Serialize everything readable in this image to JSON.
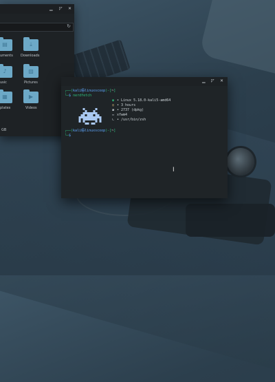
{
  "colors": {
    "prompt_green": "#2ec27e",
    "prompt_blue": "#5fa8ff",
    "folder": "#6da9c7",
    "window_bg": "#1f2427"
  },
  "file_manager": {
    "controls": [
      "minimize-icon",
      "maximize-icon",
      "close-icon"
    ],
    "refresh_icon": "refresh-icon",
    "folders": [
      {
        "label": "uments",
        "icon": "document-folder-icon"
      },
      {
        "label": "Downloads",
        "icon": "download-folder-icon"
      },
      {
        "label": "usic",
        "icon": "music-folder-icon"
      },
      {
        "label": "Pictures",
        "icon": "pictures-folder-icon"
      },
      {
        "label": "plates",
        "icon": "templates-folder-icon"
      },
      {
        "label": "Videos",
        "icon": "videos-folder-icon"
      }
    ],
    "status": "GB"
  },
  "terminal": {
    "controls": [
      "minimize-icon",
      "maximize-icon",
      "close-icon"
    ],
    "prompt": {
      "top_open": "┌──(",
      "user_host": "kali㉿linuxscoop",
      "top_close": ")-[",
      "dir": "~",
      "dir_close": "]",
      "bottom": "└─",
      "dollar": "$ "
    },
    "command": "nerdfetch",
    "info": [
      {
        "icon": "linux-icon",
        "glyph": "◉",
        "text": "• Linux 5.18.0-kali5-amd64"
      },
      {
        "icon": "uptime-icon",
        "glyph": "◎",
        "text": "• 3 hours"
      },
      {
        "icon": "packages-icon",
        "glyph": "◕",
        "text": "• 2737 (dpkg)"
      },
      {
        "icon": "wm-icon",
        "glyph": "▭",
        "text": "xfwm4"
      },
      {
        "icon": "shell-icon",
        "glyph": "∟",
        "text": "• /usr/bin/zsh"
      }
    ],
    "ascii_art": "space-invader-icon",
    "mouse_cursor": "text-cursor-icon"
  }
}
